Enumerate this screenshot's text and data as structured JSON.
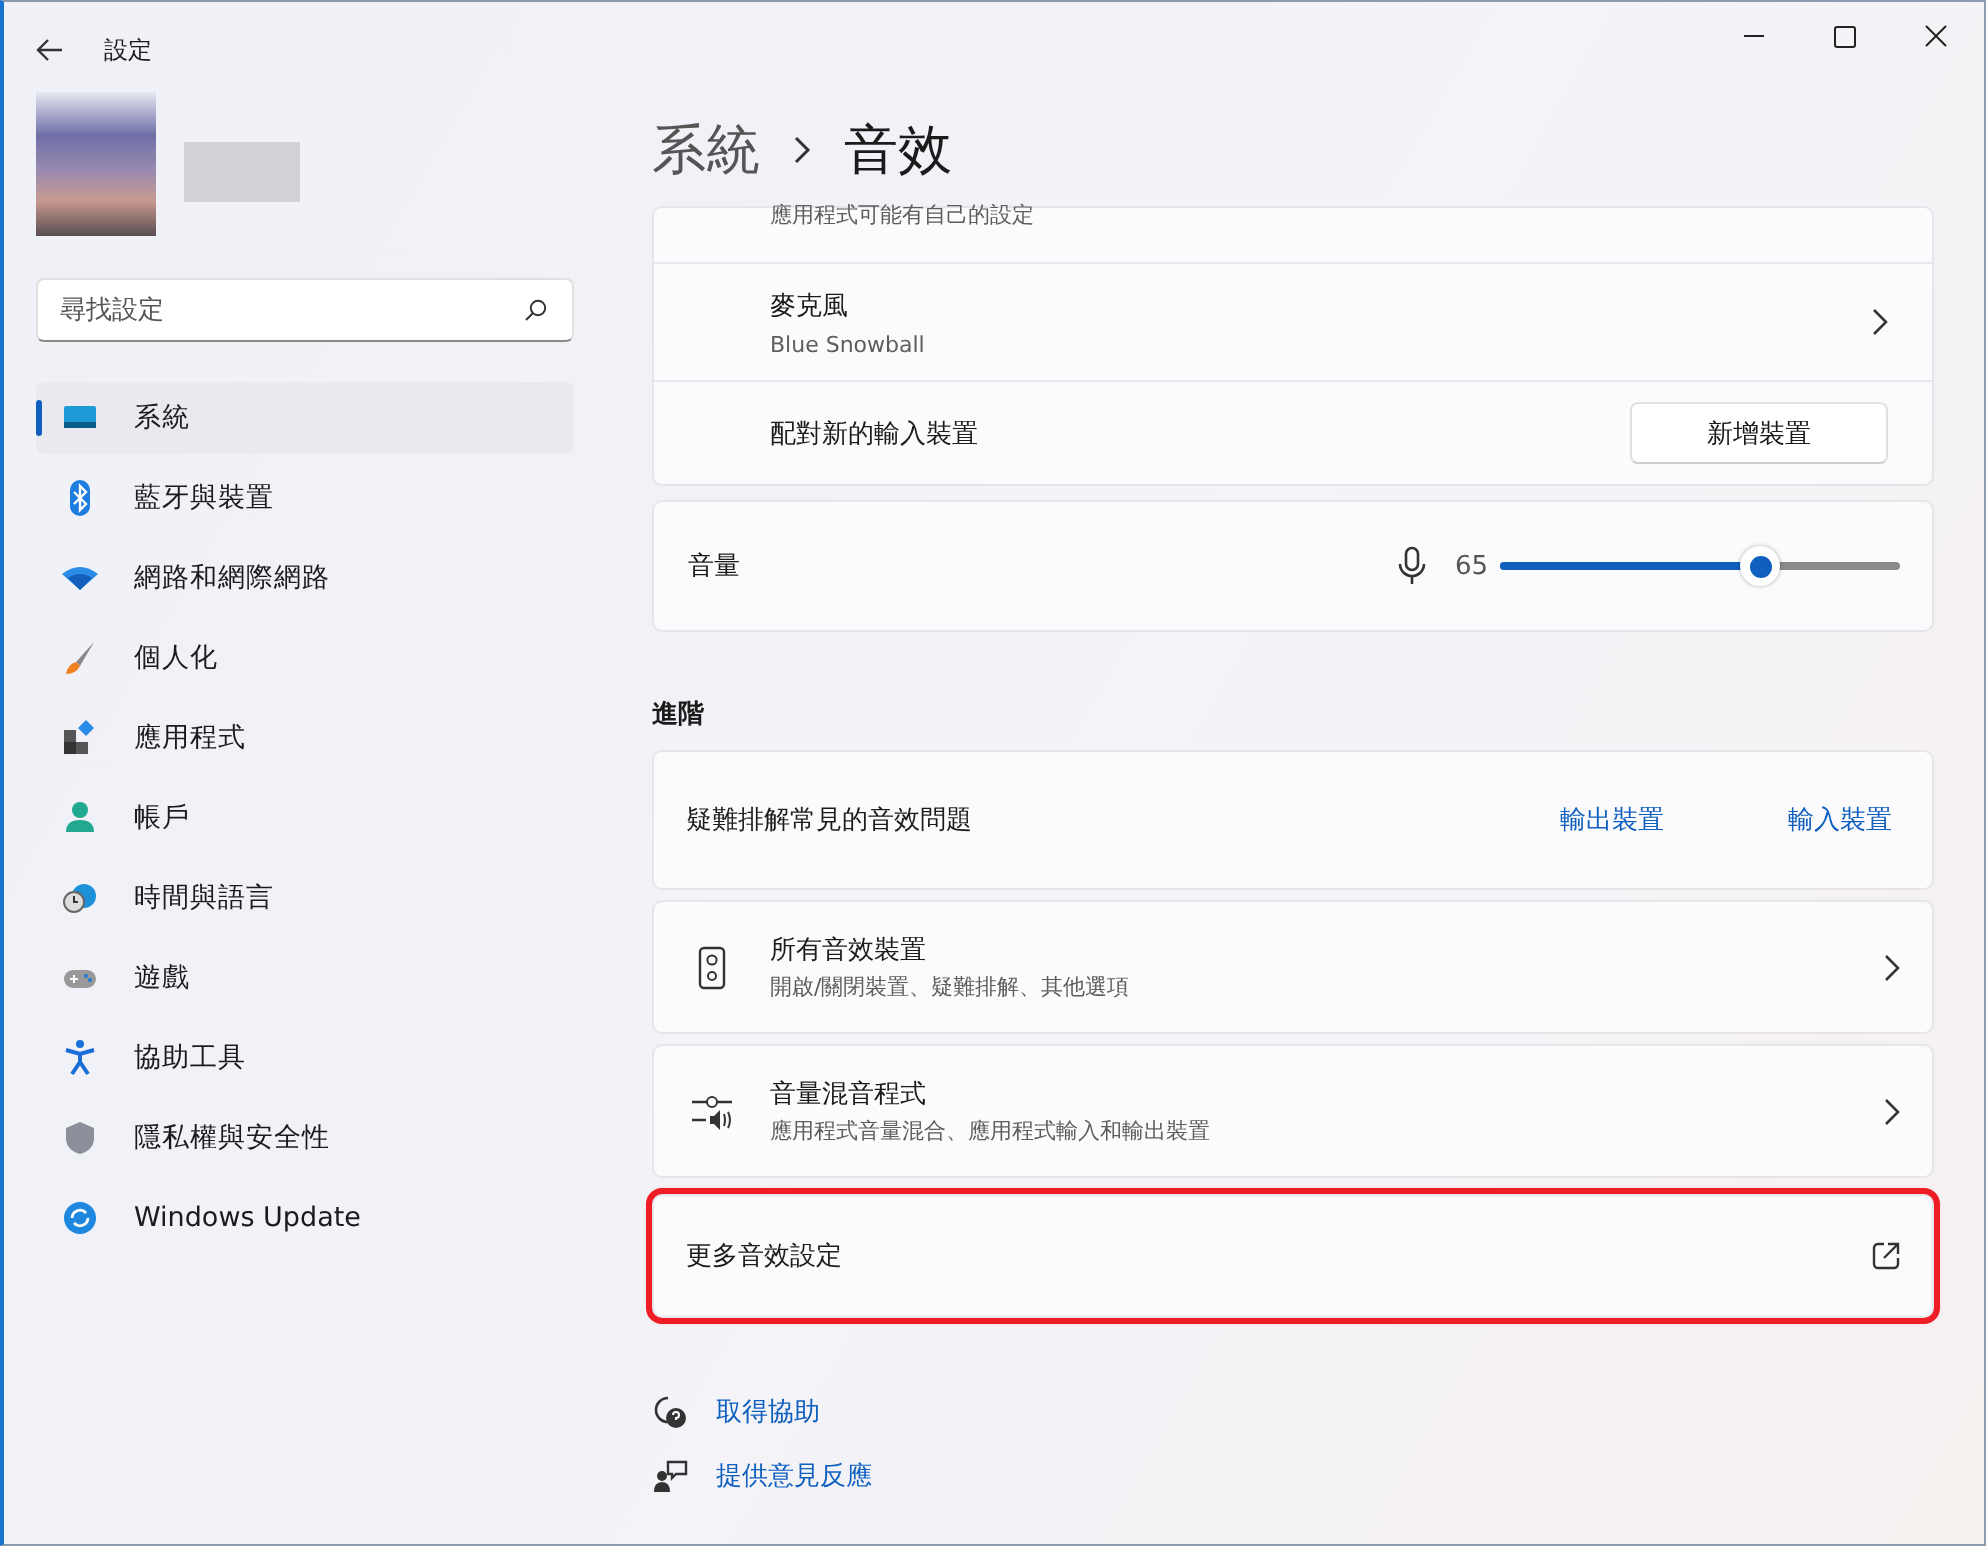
{
  "window": {
    "title": "設定"
  },
  "breadcrumb": {
    "parent": "系統",
    "current": "音效"
  },
  "sidebar": {
    "search": {
      "placeholder": "尋找設定"
    },
    "items": [
      {
        "label": "系統",
        "selected": true
      },
      {
        "label": "藍牙與裝置",
        "selected": false
      },
      {
        "label": "網路和網際網路",
        "selected": false
      },
      {
        "label": "個人化",
        "selected": false
      },
      {
        "label": "應用程式",
        "selected": false
      },
      {
        "label": "帳戶",
        "selected": false
      },
      {
        "label": "時間與語言",
        "selected": false
      },
      {
        "label": "遊戲",
        "selected": false
      },
      {
        "label": "協助工具",
        "selected": false
      },
      {
        "label": "隱私權與安全性",
        "selected": false
      },
      {
        "label": "Windows Update",
        "selected": false
      }
    ]
  },
  "input": {
    "partial_row": {
      "subtitle": "應用程式可能有自己的設定"
    },
    "device": {
      "title": "麥克風",
      "subtitle": "Blue Snowball"
    },
    "pair": {
      "label": "配對新的輸入裝置",
      "button": "新增裝置"
    }
  },
  "volume": {
    "label": "音量",
    "reading": "65",
    "level": 0.65
  },
  "advanced": {
    "heading": "進階",
    "troubleshoot": {
      "label": "疑難排解常見的音效問題",
      "links": [
        "輸出裝置",
        "輸入裝置"
      ]
    },
    "rows": [
      {
        "kind": "nav",
        "title": "所有音效裝置",
        "subtitle": "開啟/關閉裝置、疑難排解、其他選項",
        "highlighted": false
      },
      {
        "kind": "nav",
        "title": "音量混音程式",
        "subtitle": "應用程式音量混合、應用程式輸入和輸出裝置",
        "highlighted": false
      },
      {
        "kind": "external",
        "title": "更多音效設定",
        "highlighted": true
      }
    ]
  },
  "footer_links": [
    "取得協助",
    "提供意見反應"
  ]
}
